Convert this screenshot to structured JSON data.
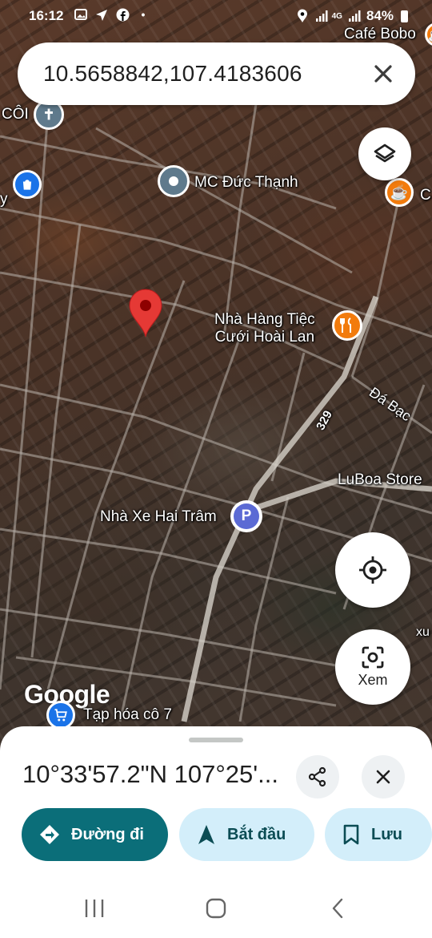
{
  "status_bar": {
    "time": "16:12",
    "network": "4G",
    "battery": "84%"
  },
  "search": {
    "query": "10.5658842,107.4183606"
  },
  "map": {
    "labels": {
      "cafe_bobo": "Café Bobo",
      "coi": "CÔI",
      "mc_duc_thanh": "MC Đức Thạnh",
      "cafe_partial": "C",
      "y_partial": "y",
      "nha_hang_line1": "Nhà Hàng Tiệc",
      "nha_hang_line2": "Cưới Hoài Lan",
      "road_329": "329",
      "da_bac": "Đá Bạc",
      "luboa": "LuBoa Store",
      "nha_xe": "Nhà Xe Hai Trâm",
      "xu_partial": "xu",
      "tap_hoa": "Tạp hóa cô 7"
    },
    "parking_letter": "P",
    "google_logo": "Google"
  },
  "controls": {
    "xem_label": "Xem"
  },
  "sheet": {
    "coordinates": "10°33'57.2\"N 107°25'...",
    "directions_label": "Đường đi",
    "start_label": "Bắt đầu",
    "save_label": "Lưu"
  },
  "colors": {
    "primary": "#0b6e79",
    "secondary": "#d3eefa",
    "pin": "#e53935",
    "poi_blue": "#1a73e8",
    "poi_orange": "#f27b0d",
    "parking": "#5b6ad4"
  },
  "icons": [
    "photo-icon",
    "send-icon",
    "facebook-icon",
    "location-icon",
    "signal-icon",
    "battery-icon",
    "close-icon",
    "layers-icon",
    "church-icon",
    "shop-icon",
    "place-icon",
    "cafe-icon",
    "restaurant-icon",
    "parking-icon",
    "cart-icon",
    "my-location-icon",
    "lens-icon",
    "share-icon",
    "directions-icon",
    "navigation-icon",
    "bookmark-icon",
    "recents-icon",
    "home-icon",
    "back-icon"
  ]
}
